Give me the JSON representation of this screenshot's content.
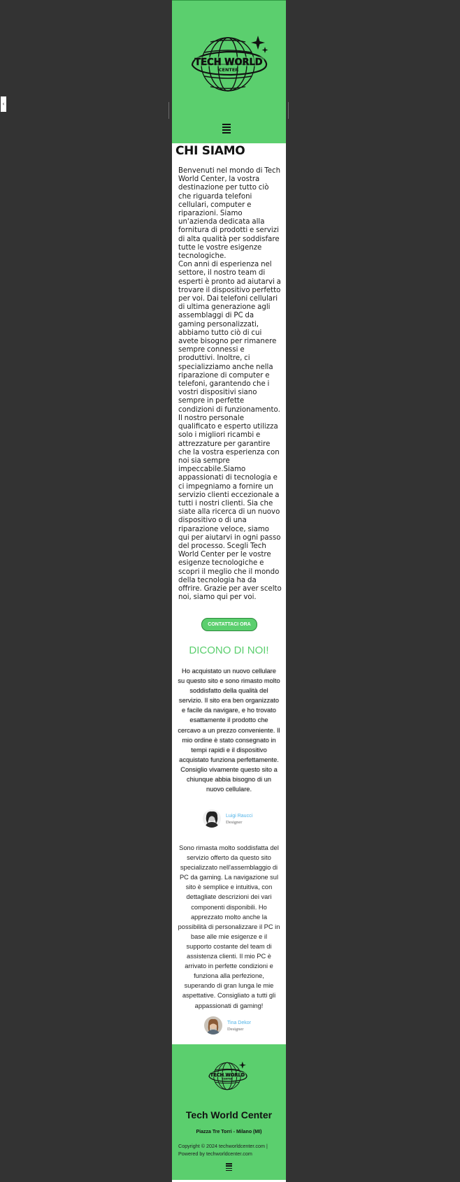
{
  "hero": {
    "logo_text_line1": "TECH WORLD",
    "logo_text_line2": "CENTER",
    "menu_icon": "hamburger-menu-icon"
  },
  "about": {
    "title": "CHI SIAMO",
    "paragraph_1": "Benvenuti nel mondo di Tech World Center, la vostra destinazione per tutto ciò che riguarda telefoni cellulari, computer e riparazioni. Siamo un'azienda dedicata alla fornitura di prodotti e servizi di alta qualità per soddisfare tutte le vostre esigenze tecnologiche.",
    "paragraph_2": "Con anni di esperienza nel settore, il nostro team di esperti è pronto ad aiutarvi a trovare il dispositivo perfetto per voi. Dai telefoni cellulari di ultima generazione agli assemblaggi di PC da gaming personalizzati, abbiamo tutto ciò di cui avete bisogno per rimanere sempre connessi e produttivi. Inoltre, ci specializziamo anche nella riparazione di computer e telefoni, garantendo che i vostri dispositivi siano sempre in perfette condizioni di funzionamento. Il nostro personale qualificato e esperto utilizza solo i migliori ricambi e attrezzature per garantire che la vostra esperienza con noi sia sempre impeccabile.Siamo appassionati di tecnologia e ci impegniamo a fornire un servizio clienti eccezionale a tutti i nostri clienti. Sia che siate alla ricerca di un nuovo dispositivo o di una riparazione veloce, siamo qui per aiutarvi in ogni passo del processo. Scegli Tech World Center per le vostre esigenze tecnologiche e scopri il meglio che il mondo della tecnologia ha da offrire. Grazie per aver scelto noi, siamo qui per voi.",
    "cta_label": "CONTATTACI ORA"
  },
  "testimonials": {
    "title": "DICONO DI NOI!",
    "items": [
      {
        "text": "Ho acquistato un nuovo cellulare su questo sito e sono rimasto molto soddisfatto della qualità del servizio. Il sito era ben organizzato e facile da navigare, e ho trovato esattamente il prodotto che cercavo a un prezzo conveniente. Il mio ordine è stato consegnato in tempi rapidi e il dispositivo acquistato funziona perfettamente. Consiglio vivamente questo sito a chiunque abbia bisogno di un nuovo cellulare.",
        "name": "Luigi Raucci",
        "role": "Designer"
      },
      {
        "text": "Sono rimasta molto soddisfatta del servizio offerto da questo sito specializzato nell'assemblaggio di PC da gaming. La navigazione sul sito è semplice e intuitiva, con dettagliate descrizioni dei vari componenti disponibili. Ho apprezzato molto anche la possibilità di personalizzare il PC in base alle mie esigenze e il supporto costante del team di assistenza clienti. Il mio PC è arrivato in perfette condizioni e funziona alla perfezione, superando di gran lunga le mie aspettative. Consigliato a tutti gli appassionati di gaming!",
        "name": "Tina Dekor",
        "role": "Designer"
      }
    ]
  },
  "footer": {
    "logo_text_line1": "TECH WORLD",
    "logo_text_line2": "CENTER",
    "title": "Tech World Center",
    "address": "Piazza Tre Torri - Milano (MI)",
    "copyright": "Copyright © 2024 techworldcenter.com | Powered by techworldcenter.com"
  },
  "colors": {
    "brand_green": "#5bcf6e",
    "outer_background": "#333333",
    "author_name": "#4fb3e8"
  }
}
